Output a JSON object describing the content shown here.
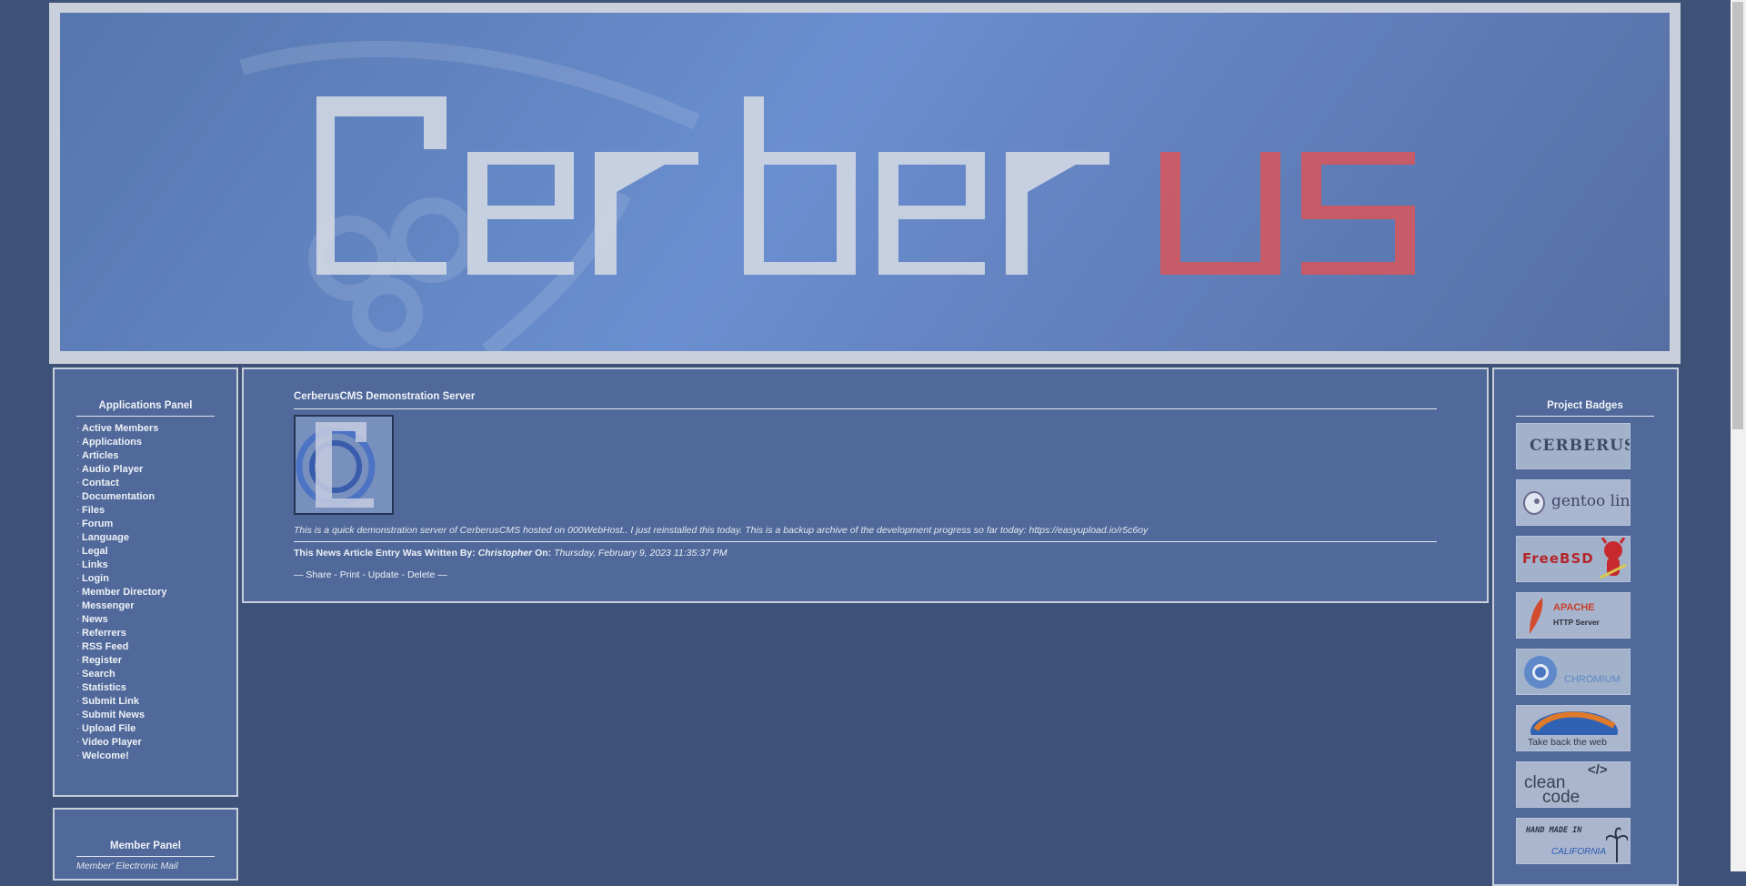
{
  "banner": {
    "logo_text": "Cerberus"
  },
  "left_panel": {
    "title": "Applications Panel",
    "bullet": "·",
    "items": [
      "Active Members",
      "Applications",
      "Articles",
      "Audio Player",
      "Contact",
      "Documentation",
      "Files",
      "Forum",
      "Language",
      "Legal",
      "Links",
      "Login",
      "Member Directory",
      "Messenger",
      "News",
      "Referrers",
      "RSS Feed",
      "Register",
      "Search",
      "Statistics",
      "Submit Link",
      "Submit News",
      "Upload File",
      "Video Player",
      "Welcome!"
    ]
  },
  "member_panel": {
    "title": "Member Panel",
    "first_line": "Member' Electronic Mail"
  },
  "news": {
    "title": "CerberusCMS Demonstration Server",
    "body": "This is a quick demonstration server of CerberusCMS hosted on 000WebHost.. I just reinstalled this today. This is a backup archive of the development progress so far today: https://easyupload.io/r5c6oy",
    "byline_prefix": "This News Article Entry Was Written By:",
    "author": "Christopher",
    "on_label": "On:",
    "date": "Thursday, February 9, 2023 11:35:37 PM",
    "actions": {
      "lead": "—",
      "share": "Share",
      "print": "Print",
      "update": "Update",
      "delete": "Delete",
      "sep": "-",
      "trail": "—"
    }
  },
  "right_panel": {
    "title": "Project Badges",
    "badges": [
      {
        "name": "cerberus",
        "text": "CERBERUS"
      },
      {
        "name": "gentoo",
        "text": "gentoo linux"
      },
      {
        "name": "freebsd",
        "text": "FreeBSD"
      },
      {
        "name": "apache",
        "text": "APACHE",
        "sub": "HTTP Server"
      },
      {
        "name": "chromium",
        "text": "CHROMIUM"
      },
      {
        "name": "firefox",
        "text": "Take back the web"
      },
      {
        "name": "cleancode",
        "text": "clean",
        "sub": "code",
        "tag": "</>"
      },
      {
        "name": "california",
        "text": "HAND MADE IN",
        "sub": "CALIFORNIA"
      }
    ]
  },
  "colors": {
    "page_bg": "#3e5176",
    "panel_bg": "#50699a",
    "panel_border": "#c7cfdd",
    "banner_red": "#d9565a"
  }
}
